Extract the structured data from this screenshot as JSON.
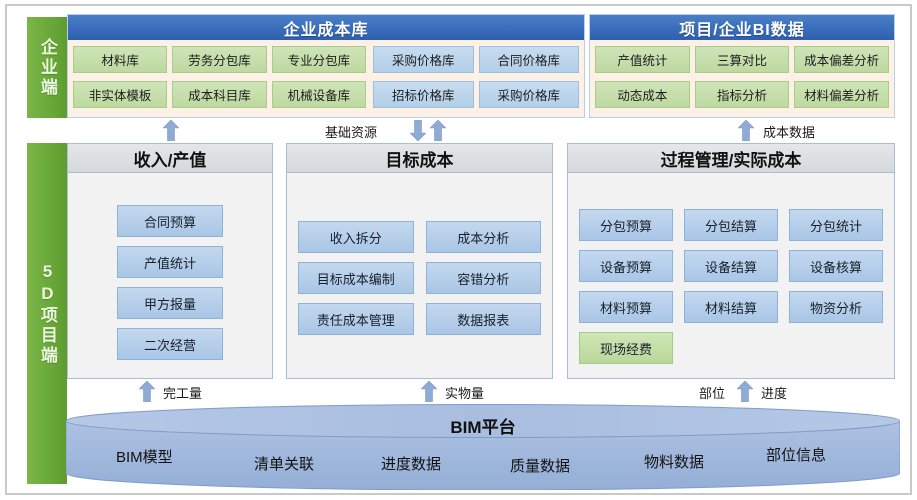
{
  "rails": {
    "enterprise": "企业端",
    "project": "5D项目端"
  },
  "enterprise": {
    "cost_library": {
      "title": "企业成本库",
      "green_chips": [
        "材料库",
        "劳务分包库",
        "专业分包库",
        "非实体模板",
        "成本科目库",
        "机械设备库"
      ],
      "blue_chips": [
        "采购价格库",
        "合同价格库",
        "招标价格库",
        "采购价格库"
      ]
    },
    "bi_data": {
      "title": "项目/企业BI数据",
      "chips": [
        "产值统计",
        "三算对比",
        "成本偏差分析",
        "动态成本",
        "指标分析",
        "材料偏差分析"
      ]
    }
  },
  "panels": {
    "income": {
      "title": "收入/产值",
      "tiles": [
        "合同预算",
        "产值统计",
        "甲方报量",
        "二次经营"
      ]
    },
    "target": {
      "title": "目标成本",
      "tiles": [
        "收入拆分",
        "成本分析",
        "目标成本编制",
        "容错分析",
        "责任成本管理",
        "数据报表"
      ]
    },
    "process": {
      "title": "过程管理/实际成本",
      "tiles": [
        "分包预算",
        "分包结算",
        "分包统计",
        "设备预算",
        "设备结算",
        "设备核算",
        "材料预算",
        "材料结算",
        "物资分析",
        "现场经费"
      ]
    }
  },
  "flows": {
    "base_resource": "基础资源",
    "cost_data": "成本数据",
    "completed_quantity": "完工量",
    "physical_quantity": "实物量",
    "position": "部位",
    "progress": "进度"
  },
  "bim": {
    "title": "BIM平台",
    "items": [
      "BIM模型",
      "清单关联",
      "进度数据",
      "质量数据",
      "物料数据",
      "部位信息"
    ]
  },
  "colors": {
    "header_blue": "#3b6fbd",
    "rail_green": "#6aa939",
    "chip_green": "#bdd9a0",
    "chip_blue": "#b3cfe9",
    "tile_blue": "#a9c6e6",
    "tile_green": "#b9d89b",
    "cylinder_blue": "#9fb8dd",
    "arrow_blue": "#8fabd4",
    "panel_bg": "#f2f2f2",
    "ent_bg": "#fdf1e6"
  }
}
